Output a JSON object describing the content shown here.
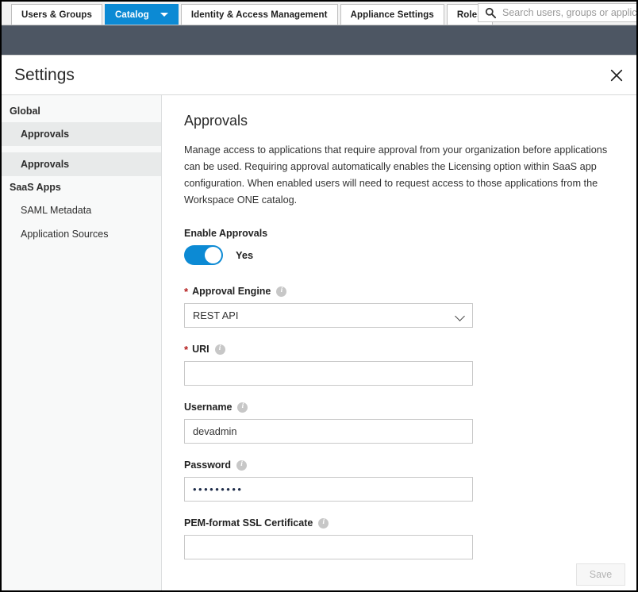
{
  "topnav": {
    "tabs": [
      {
        "label": "Users & Groups",
        "active": false,
        "has_caret": false
      },
      {
        "label": "Catalog",
        "active": true,
        "has_caret": true
      },
      {
        "label": "Identity & Access Management",
        "active": false,
        "has_caret": false
      },
      {
        "label": "Appliance Settings",
        "active": false,
        "has_caret": false
      },
      {
        "label": "Roles",
        "active": false,
        "has_caret": false
      }
    ],
    "search": {
      "placeholder": "Search users, groups or applications",
      "value": "",
      "icon": "search-icon"
    }
  },
  "panel": {
    "title": "Settings",
    "close_icon": "close-icon"
  },
  "sidebar": {
    "groups": [
      {
        "label": "Global",
        "items": [
          {
            "label": "Approvals",
            "selected": true,
            "bold": true
          }
        ]
      },
      {
        "label": "",
        "items": [
          {
            "label": "Approvals",
            "selected": true,
            "bold": true
          }
        ]
      },
      {
        "label": "SaaS Apps",
        "items": [
          {
            "label": "SAML Metadata",
            "selected": false,
            "bold": false
          },
          {
            "label": "Application Sources",
            "selected": false,
            "bold": false
          }
        ]
      }
    ]
  },
  "main": {
    "heading": "Approvals",
    "description": "Manage access to applications that require approval from your organization before applications can be used. Requiring approval automatically enables the Licensing option within SaaS app configuration. When enabled users will need to request access to those applications from the Workspace ONE catalog.",
    "enable_approvals": {
      "label": "Enable Approvals",
      "toggle_state": "on",
      "toggle_value_label": "Yes"
    },
    "fields": [
      {
        "name": "approval-engine",
        "label": "Approval Engine",
        "required": true,
        "info": true,
        "type": "select",
        "value": "REST API",
        "options": [
          "REST API"
        ]
      },
      {
        "name": "uri",
        "label": "URI",
        "required": true,
        "info": true,
        "type": "text",
        "value": "",
        "placeholder": ""
      },
      {
        "name": "username",
        "label": "Username",
        "required": false,
        "info": true,
        "type": "text",
        "value": "devadmin",
        "placeholder": ""
      },
      {
        "name": "password",
        "label": "Password",
        "required": false,
        "info": true,
        "type": "password",
        "value": "•••••••••",
        "placeholder": ""
      },
      {
        "name": "pem-ssl-certificate",
        "label": "PEM-format SSL Certificate",
        "required": false,
        "info": true,
        "type": "text",
        "value": "",
        "placeholder": ""
      }
    ],
    "save_button": {
      "label": "Save",
      "disabled": true
    }
  },
  "colors": {
    "accent_blue": "#0c8ad4",
    "dark_band": "#4d5663",
    "required_red": "#b31b1b",
    "sidebar_bg": "#f8f9f9",
    "sidebar_selected": "#e8eaea"
  },
  "icons": {
    "info": "i"
  }
}
